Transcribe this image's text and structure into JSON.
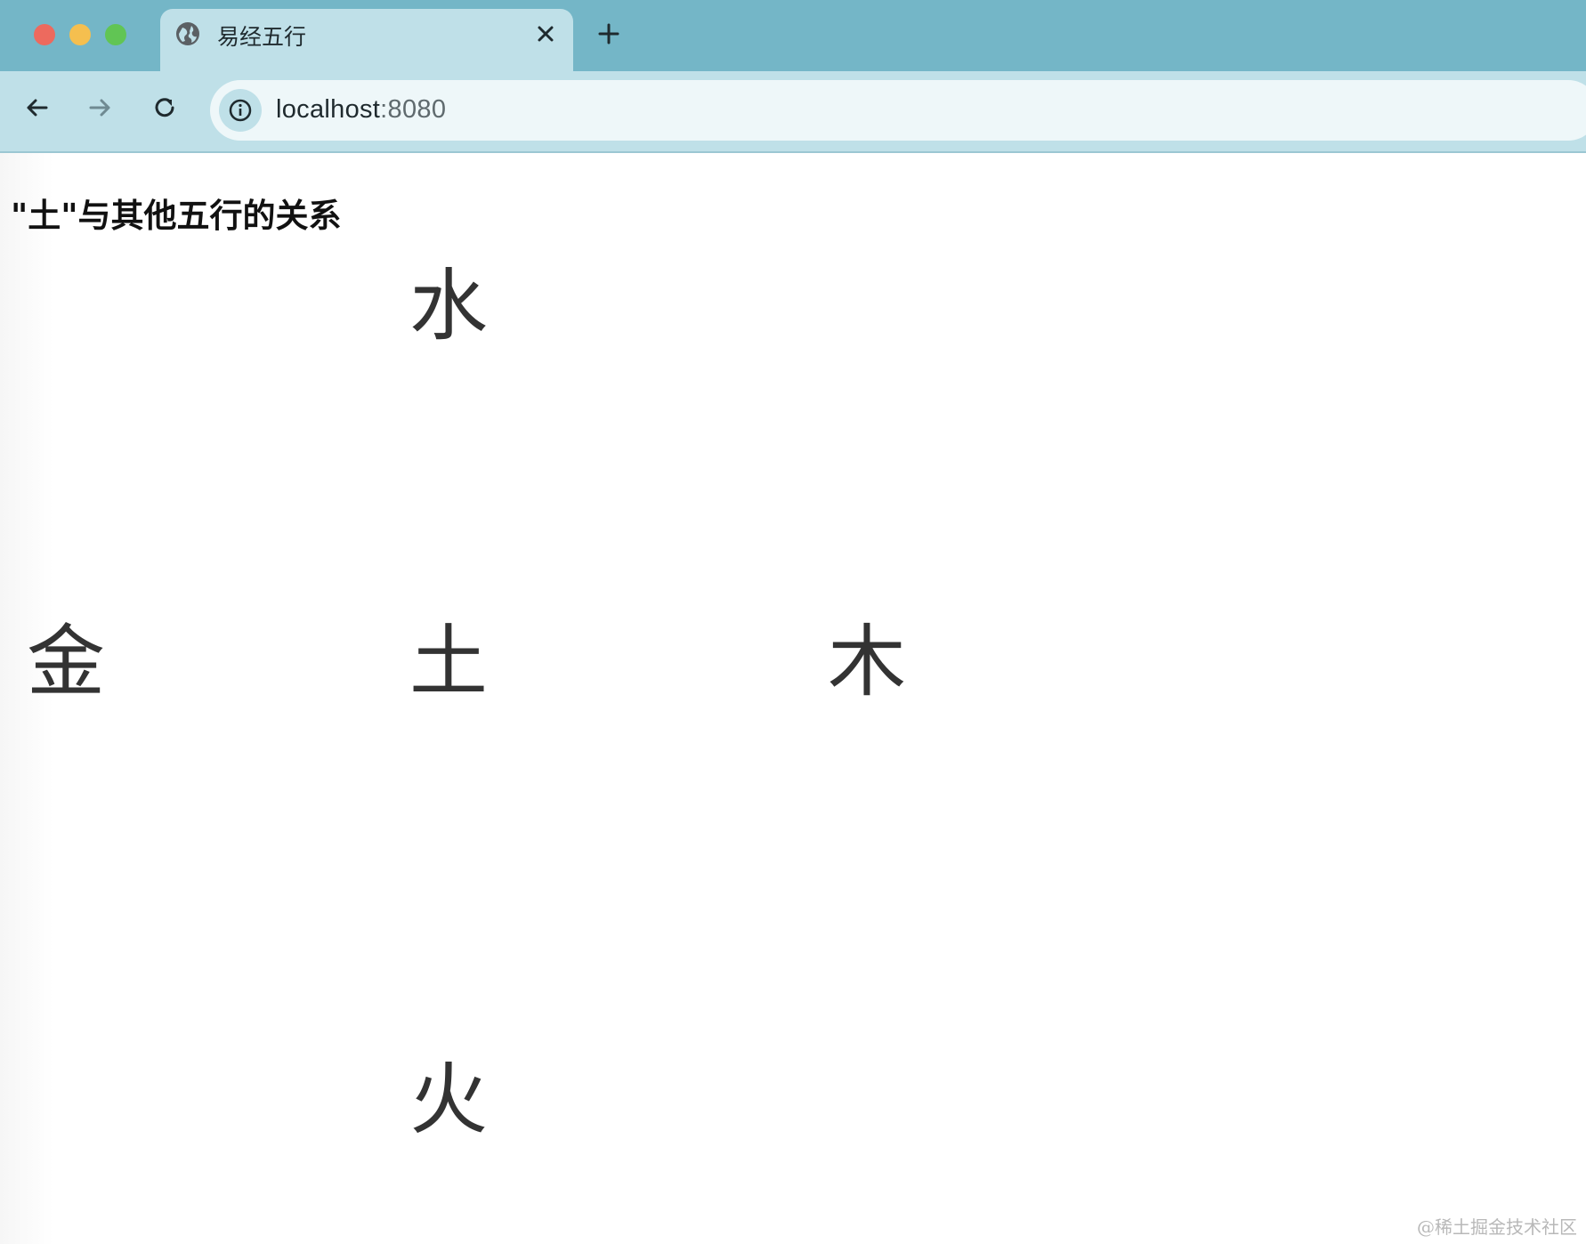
{
  "browser": {
    "tab": {
      "title": "易经五行",
      "icon": "globe-icon"
    },
    "url": {
      "host": "localhost",
      "port": ":8080"
    }
  },
  "page": {
    "heading": "\"土\"与其他五行的关系",
    "elements": {
      "water": "水",
      "metal": "金",
      "earth": "土",
      "wood": "木",
      "fire": "火"
    }
  },
  "watermark": "@稀土掘金技术社区"
}
